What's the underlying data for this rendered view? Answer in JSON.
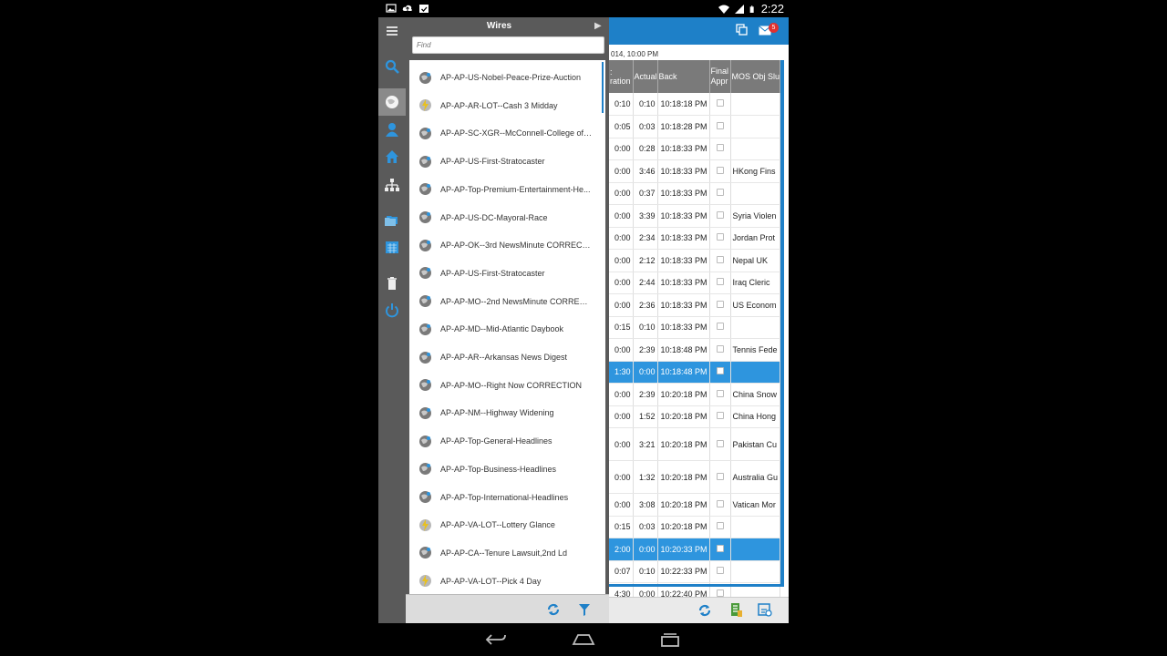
{
  "status_bar": {
    "time": "2:22"
  },
  "wires_panel": {
    "title": "Wires",
    "find_placeholder": "Find",
    "items": [
      {
        "label": "AP-AP-US-Nobel-Peace-Prize-Auction",
        "icon": "globe-icon"
      },
      {
        "label": "AP-AP-AR-LOT--Cash 3 Midday",
        "icon": "flash-icon"
      },
      {
        "label": "AP-AP-SC-XGR--McConnell-College of C...",
        "icon": "globe-icon"
      },
      {
        "label": "AP-AP-US-First-Stratocaster",
        "icon": "globe-icon"
      },
      {
        "label": "AP-AP-Top-Premium-Entertainment-He...",
        "icon": "globe-icon"
      },
      {
        "label": "AP-AP-US-DC-Mayoral-Race",
        "icon": "globe-icon"
      },
      {
        "label": "AP-AP-OK--3rd NewsMinute CORRECTI...",
        "icon": "globe-icon"
      },
      {
        "label": "AP-AP-US-First-Stratocaster",
        "icon": "globe-icon"
      },
      {
        "label": "AP-AP-MO--2nd NewsMinute CORRECT...",
        "icon": "globe-icon"
      },
      {
        "label": "AP-AP-MD--Mid-Atlantic Daybook",
        "icon": "globe-icon"
      },
      {
        "label": "AP-AP-AR--Arkansas News Digest",
        "icon": "globe-icon"
      },
      {
        "label": "AP-AP-MO--Right Now CORRECTION",
        "icon": "globe-icon"
      },
      {
        "label": "AP-AP-NM--Highway Widening",
        "icon": "globe-icon"
      },
      {
        "label": "AP-AP-Top-General-Headlines",
        "icon": "globe-icon"
      },
      {
        "label": "AP-AP-Top-Business-Headlines",
        "icon": "globe-icon"
      },
      {
        "label": "AP-AP-Top-International-Headlines",
        "icon": "globe-icon"
      },
      {
        "label": "AP-AP-VA-LOT--Lottery Glance",
        "icon": "flash-icon"
      },
      {
        "label": "AP-AP-CA--Tenure Lawsuit,2nd Ld",
        "icon": "globe-icon"
      },
      {
        "label": "AP-AP-VA-LOT--Pick 4 Day",
        "icon": "flash-icon"
      }
    ]
  },
  "rundown": {
    "date_text": "014, 10:00 PM",
    "mail_badge": "5",
    "headers": [
      "ration",
      "Actual",
      "Back",
      "Final Appr",
      "MOS Obj Slu"
    ],
    "header_col0_top": ":",
    "rows": [
      {
        "dur": "0:10",
        "actual": "0:10",
        "back": "10:18:18 PM",
        "mos": "",
        "selected": false,
        "tall": false
      },
      {
        "dur": "0:05",
        "actual": "0:03",
        "back": "10:18:28 PM",
        "mos": "",
        "selected": false,
        "tall": false
      },
      {
        "dur": "0:00",
        "actual": "0:28",
        "back": "10:18:33 PM",
        "mos": "",
        "selected": false,
        "tall": false
      },
      {
        "dur": "0:00",
        "actual": "3:46",
        "back": "10:18:33 PM",
        "mos": "HKong Fins",
        "selected": false,
        "tall": false
      },
      {
        "dur": "0:00",
        "actual": "0:37",
        "back": "10:18:33 PM",
        "mos": "",
        "selected": false,
        "tall": false
      },
      {
        "dur": "0:00",
        "actual": "3:39",
        "back": "10:18:33 PM",
        "mos": "Syria Violen",
        "selected": false,
        "tall": false
      },
      {
        "dur": "0:00",
        "actual": "2:34",
        "back": "10:18:33 PM",
        "mos": "Jordan Prot",
        "selected": false,
        "tall": false
      },
      {
        "dur": "0:00",
        "actual": "2:12",
        "back": "10:18:33 PM",
        "mos": "Nepal UK",
        "selected": false,
        "tall": false
      },
      {
        "dur": "0:00",
        "actual": "2:44",
        "back": "10:18:33 PM",
        "mos": "Iraq Cleric",
        "selected": false,
        "tall": false
      },
      {
        "dur": "0:00",
        "actual": "2:36",
        "back": "10:18:33 PM",
        "mos": "US Econom",
        "selected": false,
        "tall": false
      },
      {
        "dur": "0:15",
        "actual": "0:10",
        "back": "10:18:33 PM",
        "mos": "",
        "selected": false,
        "tall": false
      },
      {
        "dur": "0:00",
        "actual": "2:39",
        "back": "10:18:48 PM",
        "mos": "Tennis Fede",
        "selected": false,
        "tall": false
      },
      {
        "dur": "1:30",
        "actual": "0:00",
        "back": "10:18:48 PM",
        "mos": "",
        "selected": true,
        "tall": false
      },
      {
        "dur": "0:00",
        "actual": "2:39",
        "back": "10:20:18 PM",
        "mos": "China Snow",
        "selected": false,
        "tall": false
      },
      {
        "dur": "0:00",
        "actual": "1:52",
        "back": "10:20:18 PM",
        "mos": "China Hong",
        "selected": false,
        "tall": false
      },
      {
        "dur": "0:00",
        "actual": "3:21",
        "back": "10:20:18 PM",
        "mos": "Pakistan Cu",
        "selected": false,
        "tall": true
      },
      {
        "dur": "0:00",
        "actual": "1:32",
        "back": "10:20:18 PM",
        "mos": "Australia Gu",
        "selected": false,
        "tall": true
      },
      {
        "dur": "0:00",
        "actual": "3:08",
        "back": "10:20:18 PM",
        "mos": "Vatican Mor",
        "selected": false,
        "tall": false
      },
      {
        "dur": "0:15",
        "actual": "0:03",
        "back": "10:20:18 PM",
        "mos": "",
        "selected": false,
        "tall": false
      },
      {
        "dur": "2:00",
        "actual": "0:00",
        "back": "10:20:33 PM",
        "mos": "",
        "selected": true,
        "tall": false
      },
      {
        "dur": "0:07",
        "actual": "0:10",
        "back": "10:22:33 PM",
        "mos": "",
        "selected": false,
        "tall": false
      },
      {
        "dur": "4:30",
        "actual": "0:00",
        "back": "10:22:40 PM",
        "mos": "",
        "selected": false,
        "tall": false
      }
    ]
  },
  "colors": {
    "accent": "#1e80c8",
    "selected_row": "#2e95de",
    "sidebar": "#5a5a5a"
  }
}
